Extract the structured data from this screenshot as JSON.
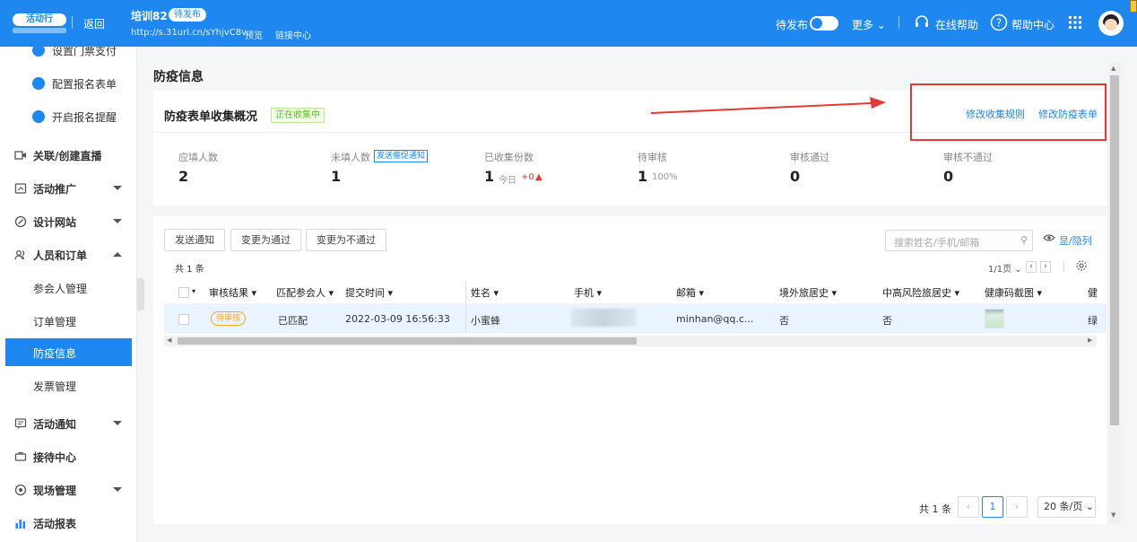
{
  "topbar": {
    "logo_text": "活动行",
    "back": "返回",
    "event_title": "培训82",
    "event_status": "待发布",
    "event_url": "http://s.31url.cn/sYhjvC8v",
    "preview": "预览",
    "link_center": "链接中心",
    "publish_label": "待发布",
    "more": "更多",
    "online_help": "在线帮助",
    "help_center": "帮助中心"
  },
  "sidebar": {
    "sub_items": [
      "设置门票支付",
      "配置报名表单",
      "开启报名提醒"
    ],
    "items": [
      "关联/创建直播",
      "活动推广",
      "设计网站",
      "人员和订单"
    ],
    "children": [
      "参会人管理",
      "订单管理",
      "防疫信息",
      "发票管理"
    ],
    "bottom_items": [
      "活动通知",
      "接待中心",
      "现场管理",
      "活动报表"
    ]
  },
  "main": {
    "page_title": "防疫信息",
    "overview": {
      "title": "防疫表单收集概况",
      "status_badge": "正在收集中",
      "modify_rules": "修改收集规则",
      "modify_form": "修改防疫表单"
    },
    "stats": [
      {
        "label": "应填人数",
        "value": "2"
      },
      {
        "label": "未填人数",
        "value": "1",
        "action": "发送催促通知"
      },
      {
        "label": "已收集份数",
        "value": "1",
        "extra": "今日",
        "delta": "+0"
      },
      {
        "label": "待审核",
        "value": "1",
        "extra": "100%"
      },
      {
        "label": "审核通过",
        "value": "0"
      },
      {
        "label": "审核不通过",
        "value": "0"
      }
    ],
    "toolbar": {
      "send_notice": "发送通知",
      "set_pass": "变更为通过",
      "set_fail": "变更为不通过",
      "search_placeholder": "搜索姓名/手机/邮箱",
      "show_hide_columns": "显/隐列"
    },
    "table": {
      "total": "共 1 条",
      "mini_page": "1/1页",
      "columns": [
        "审核结果",
        "匹配参会人",
        "提交时间",
        "姓名",
        "手机",
        "邮箱",
        "境外旅居史",
        "中高风险旅居史",
        "健康码截图",
        "健"
      ],
      "rows": [
        {
          "status": "待审核",
          "match": "已匹配",
          "submit_time": "2022-03-09 16:56:33",
          "name": "小蜜蜂",
          "email": "minhan@qq.c...",
          "overseas": "否",
          "risk_area": "否",
          "extra": "绿"
        }
      ]
    },
    "pagination": {
      "total": "共 1 条",
      "current_page": "1",
      "page_size": "20 条/页"
    }
  },
  "colors": {
    "primary": "#1e88f0",
    "warning": "#f5a623",
    "success": "#52c41a",
    "annotation": "#e53935"
  }
}
